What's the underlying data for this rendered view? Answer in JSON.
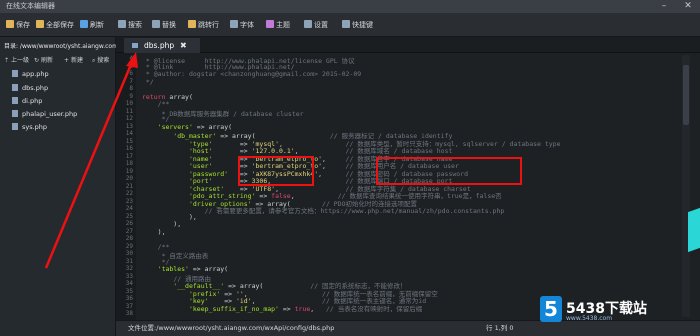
{
  "window": {
    "title": "在线文本编辑器"
  },
  "toolbar": {
    "buttons": [
      {
        "label": "保存",
        "color": "#e2b45a"
      },
      {
        "label": "全部保存",
        "color": "#e2b45a"
      },
      {
        "label": "刷新",
        "color": "#5aa0e2"
      },
      {
        "label": "搜索",
        "color": "#8fa3b7"
      },
      {
        "label": "替换",
        "color": "#8fa3b7"
      },
      {
        "label": "跳转行",
        "color": "#e2b45a"
      },
      {
        "label": "字体",
        "color": "#8fa3b7"
      },
      {
        "label": "主题",
        "color": "#c07ad8"
      },
      {
        "label": "设置",
        "color": "#8fa3b7"
      },
      {
        "label": "快捷键",
        "color": "#8fa3b7"
      }
    ]
  },
  "sidebar": {
    "directory": "目录: /www/wwwroot/ysht.aiangw.com/wxApi/config",
    "actions": [
      "上一级",
      "刷新",
      "新建",
      "搜索"
    ],
    "files": [
      "app.php",
      "dbs.php",
      "di.php",
      "phalapi_user.php",
      "sys.php"
    ]
  },
  "tabs": [
    {
      "label": "dbs.php"
    }
  ],
  "editor": {
    "line_numbers": [
      "4",
      "5",
      "6",
      "7",
      "8",
      "9",
      "10",
      "11",
      "12",
      "13",
      "14",
      "15",
      "16",
      "17",
      "18",
      "19",
      "20",
      "21",
      "22",
      "23",
      "24",
      "25",
      "26",
      "27",
      "28",
      "29",
      "30",
      "31",
      "32",
      "33",
      "34",
      "35",
      "36",
      "37",
      "38"
    ],
    "lines": [
      [
        {
          "t": " * @license     http://www.phalapi.net/license GPL 协议",
          "c": "cm"
        }
      ],
      [
        {
          "t": " * @link        http://www.phalapi.net/",
          "c": "cm"
        }
      ],
      [
        {
          "t": " * @author: dogstar <chanzonghuang@gmail.com> 2015-02-09",
          "c": "cm"
        }
      ],
      [
        {
          "t": " */",
          "c": "cm"
        }
      ],
      [
        {
          "t": "",
          "c": ""
        }
      ],
      [
        {
          "t": "return ",
          "c": "kw"
        },
        {
          "t": "array(",
          "c": ""
        }
      ],
      [
        {
          "t": "    /**",
          "c": "cm"
        }
      ],
      [
        {
          "t": "     * DB数据库服务器集群 / database cluster",
          "c": "cm"
        }
      ],
      [
        {
          "t": "     */",
          "c": "cm"
        }
      ],
      [
        {
          "t": "    'servers' ",
          "c": "ky"
        },
        {
          "t": "=> array(",
          "c": ""
        }
      ],
      [
        {
          "t": "        'db_master' ",
          "c": "ky"
        },
        {
          "t": "=> array(                   ",
          "c": ""
        },
        {
          "t": "// 服务器标记 / database identify",
          "c": "cm"
        }
      ],
      [
        {
          "t": "            'type'       ",
          "c": "ky"
        },
        {
          "t": "=> ",
          "c": ""
        },
        {
          "t": "'mysql'",
          "c": "str"
        },
        {
          "t": ",                ",
          "c": ""
        },
        {
          "t": "// 数据库类型，暂时只支持：mysql, sqlserver / database type",
          "c": "cm"
        }
      ],
      [
        {
          "t": "            'host'       ",
          "c": "ky"
        },
        {
          "t": "=> ",
          "c": ""
        },
        {
          "t": "'127.0.0.1'",
          "c": "str"
        },
        {
          "t": ",            ",
          "c": ""
        },
        {
          "t": "// 数据库域名 / database host",
          "c": "cm"
        }
      ],
      [
        {
          "t": "            'name'       ",
          "c": "ky"
        },
        {
          "t": "=> ",
          "c": ""
        },
        {
          "t": "'bertram_etpro_to'",
          "c": "str"
        },
        {
          "t": ",     ",
          "c": ""
        },
        {
          "t": "// 数据库名字 / database name",
          "c": "cm"
        }
      ],
      [
        {
          "t": "            'user'       ",
          "c": "ky"
        },
        {
          "t": "=> ",
          "c": ""
        },
        {
          "t": "'bertram_etpro_to'",
          "c": "str"
        },
        {
          "t": ",     ",
          "c": ""
        },
        {
          "t": "// 数据库用户名 / database user",
          "c": "cm"
        }
      ],
      [
        {
          "t": "            'password'   ",
          "c": "ky"
        },
        {
          "t": "=> ",
          "c": ""
        },
        {
          "t": "'aXK87yssPCmxhk4'",
          "c": "str"
        },
        {
          "t": ",      ",
          "c": ""
        },
        {
          "t": "// 数据库密码 / database password",
          "c": "cm"
        }
      ],
      [
        {
          "t": "            'port'       ",
          "c": "ky"
        },
        {
          "t": "=> ",
          "c": ""
        },
        {
          "t": "3306",
          "c": "str"
        },
        {
          "t": ",                   ",
          "c": ""
        },
        {
          "t": "// 数据库端口 / database port",
          "c": "cm"
        }
      ],
      [
        {
          "t": "            'charset'    ",
          "c": "ky"
        },
        {
          "t": "=> ",
          "c": ""
        },
        {
          "t": "'UTF8'",
          "c": "str"
        },
        {
          "t": ",                 ",
          "c": ""
        },
        {
          "t": "// 数据库字符集 / database charset",
          "c": "cm"
        }
      ],
      [
        {
          "t": "            'pdo_attr_string' ",
          "c": "ky"
        },
        {
          "t": "=> ",
          "c": ""
        },
        {
          "t": "false",
          "c": "kw"
        },
        {
          "t": ",           ",
          "c": ""
        },
        {
          "t": "// 数据库查询结果统一使用字符串，true是，false否",
          "c": "cm"
        }
      ],
      [
        {
          "t": "            'driver_options' ",
          "c": "ky"
        },
        {
          "t": "=> array(        ",
          "c": ""
        },
        {
          "t": "// PDO初始化时的连接选项配置",
          "c": "cm"
        }
      ],
      [
        {
          "t": "                ",
          "c": ""
        },
        {
          "t": "// 若需要更多配置，请参考官方文档：https://www.php.net/manual/zh/pdo.constants.php",
          "c": "cm"
        }
      ],
      [
        {
          "t": "            ),",
          "c": ""
        }
      ],
      [
        {
          "t": "        ),",
          "c": ""
        }
      ],
      [
        {
          "t": "    ),",
          "c": ""
        }
      ],
      [
        {
          "t": "",
          "c": ""
        }
      ],
      [
        {
          "t": "    /**",
          "c": "cm"
        }
      ],
      [
        {
          "t": "     * 自定义路由表",
          "c": "cm"
        }
      ],
      [
        {
          "t": "     */",
          "c": "cm"
        }
      ],
      [
        {
          "t": "    'tables' ",
          "c": "ky"
        },
        {
          "t": "=> array(",
          "c": ""
        }
      ],
      [
        {
          "t": "        ",
          "c": ""
        },
        {
          "t": "// 通用路由",
          "c": "cm"
        }
      ],
      [
        {
          "t": "        '__default__' ",
          "c": "ky"
        },
        {
          "t": "=> array(            ",
          "c": ""
        },
        {
          "t": "// 固定的系统标志，不能修改！",
          "c": "cm"
        }
      ],
      [
        {
          "t": "            'prefix' ",
          "c": "ky"
        },
        {
          "t": "=> ",
          "c": ""
        },
        {
          "t": "''",
          "c": "str"
        },
        {
          "t": ",                   ",
          "c": ""
        },
        {
          "t": "// 数据库统一表名前缀，无前缀保留空",
          "c": "cm"
        }
      ],
      [
        {
          "t": "            'key'    ",
          "c": "ky"
        },
        {
          "t": "=> ",
          "c": ""
        },
        {
          "t": "'id'",
          "c": "str"
        },
        {
          "t": ",                 ",
          "c": ""
        },
        {
          "t": "// 数据库统一表主键名，通常为id",
          "c": "cm"
        }
      ],
      [
        {
          "t": "            'keep_suffix_if_no_map' ",
          "c": "ky"
        },
        {
          "t": "=> ",
          "c": ""
        },
        {
          "t": "true",
          "c": "kw"
        },
        {
          "t": ",   ",
          "c": ""
        },
        {
          "t": "// 当表名没有映射时，保留后缀",
          "c": "cm"
        }
      ],
      [
        {
          "t": "",
          "c": ""
        }
      ]
    ]
  },
  "status": {
    "file_path": "文件位置:/www/wwwroot/ysht.aiangw.com/wxApi/config/dbs.php",
    "cursor": "行 1,列 0"
  },
  "watermark": {
    "logo": "5",
    "brand": "5438下载站",
    "url": "www.5438.com"
  }
}
